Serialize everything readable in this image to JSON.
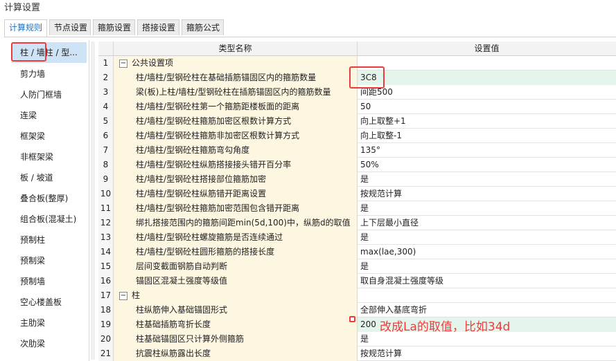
{
  "window": {
    "title": "计算设置"
  },
  "tabs": [
    {
      "label": "计算规则"
    },
    {
      "label": "节点设置"
    },
    {
      "label": "箍筋设置"
    },
    {
      "label": "搭接设置"
    },
    {
      "label": "箍筋公式"
    }
  ],
  "sidebar": {
    "items": [
      {
        "label": "柱 / 墙柱 / 型..."
      },
      {
        "label": "剪力墙"
      },
      {
        "label": "人防门框墙"
      },
      {
        "label": "连梁"
      },
      {
        "label": "框架梁"
      },
      {
        "label": "非框架梁"
      },
      {
        "label": "板 / 坡道"
      },
      {
        "label": "叠合板(整厚)"
      },
      {
        "label": "组合板(混凝土)"
      },
      {
        "label": "预制柱"
      },
      {
        "label": "预制梁"
      },
      {
        "label": "预制墙"
      },
      {
        "label": "空心楼盖板"
      },
      {
        "label": "主肋梁"
      },
      {
        "label": "次肋梁"
      }
    ]
  },
  "grid": {
    "col_name": "类型名称",
    "col_value": "设置值",
    "rows": [
      {
        "num": "1",
        "group": true,
        "toggle": "−",
        "name": "公共设置项",
        "value": ""
      },
      {
        "num": "2",
        "name": "柱/墙柱/型钢砼柱在基础插筋锚固区内的箍筋数量",
        "value": "3C8",
        "highlight": true
      },
      {
        "num": "3",
        "name": "梁(板)上柱/墙柱/型钢砼柱在插筋锚固区内的箍筋数量",
        "value": "间距500"
      },
      {
        "num": "4",
        "name": "柱/墙柱/型钢砼柱第一个箍筋距楼板面的距离",
        "value": "50"
      },
      {
        "num": "5",
        "name": "柱/墙柱/型钢砼柱箍筋加密区根数计算方式",
        "value": "向上取整+1"
      },
      {
        "num": "6",
        "name": "柱/墙柱/型钢砼柱箍筋非加密区根数计算方式",
        "value": "向上取整-1"
      },
      {
        "num": "7",
        "name": "柱/墙柱/型钢砼柱箍筋弯勾角度",
        "value": "135°"
      },
      {
        "num": "8",
        "name": "柱/墙柱/型钢砼柱纵筋搭接接头错开百分率",
        "value": "50%"
      },
      {
        "num": "9",
        "name": "柱/墙柱/型钢砼柱搭接部位箍筋加密",
        "value": "是"
      },
      {
        "num": "10",
        "name": "柱/墙柱/型钢砼柱纵筋错开距离设置",
        "value": "按规范计算"
      },
      {
        "num": "11",
        "name": "柱/墙柱/型钢砼柱箍筋加密范围包含错开距离",
        "value": "是"
      },
      {
        "num": "12",
        "name": "绑扎搭接范围内的箍筋间距min(5d,100)中，纵筋d的取值",
        "value": "上下层最小直径"
      },
      {
        "num": "13",
        "name": "柱/墙柱/型钢砼柱螺旋箍筋是否连续通过",
        "value": "是"
      },
      {
        "num": "14",
        "name": "柱/墙柱/型钢砼柱圆形箍筋的搭接长度",
        "value": "max(lae,300)"
      },
      {
        "num": "15",
        "name": "层间变截面钢筋自动判断",
        "value": "是"
      },
      {
        "num": "16",
        "name": "锚固区混凝土强度等级值",
        "value": "取自身混凝土强度等级"
      },
      {
        "num": "17",
        "group": true,
        "toggle": "−",
        "name": "柱",
        "value": ""
      },
      {
        "num": "18",
        "name": "柱纵筋伸入基础锚固形式",
        "value": "全部伸入基底弯折"
      },
      {
        "num": "19",
        "name": "柱基础插筋弯折长度",
        "value": "200",
        "highlight": true
      },
      {
        "num": "20",
        "name": "柱基础锚固区只计算外侧箍筋",
        "value": "是"
      },
      {
        "num": "21",
        "name": "抗震柱纵筋露出长度",
        "value": "按规范计算"
      }
    ]
  },
  "annotation": {
    "text": "改成La的取值，比如34d",
    "color": "#ee3b3b"
  }
}
